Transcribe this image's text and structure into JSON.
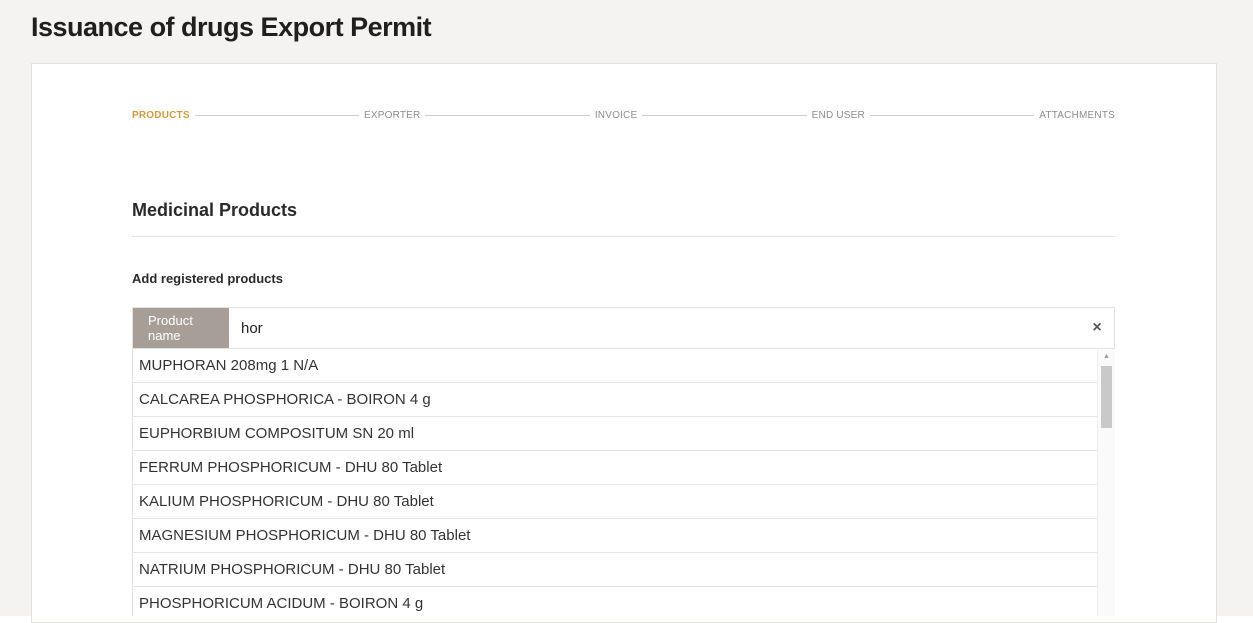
{
  "page": {
    "title": "Issuance of drugs Export Permit"
  },
  "stepper": {
    "steps": [
      "PRODUCTS",
      "EXPORTER",
      "INVOICE",
      "END USER",
      "ATTACHMENTS"
    ],
    "active_step": "PRODUCTS"
  },
  "section": {
    "title": "Medicinal Products",
    "subtitle": "Add registered products"
  },
  "search": {
    "label": "Product name",
    "value": "hor",
    "clear_symbol": "×"
  },
  "dropdown": {
    "items": [
      "MUPHORAN 208mg 1 N/A",
      "CALCAREA PHOSPHORICA - BOIRON 4 g",
      "EUPHORBIUM COMPOSITUM SN 20 ml",
      "FERRUM PHOSPHORICUM - DHU 80 Tablet",
      "KALIUM PHOSPHORICUM - DHU 80 Tablet",
      "MAGNESIUM PHOSPHORICUM - DHU 80 Tablet",
      "NATRIUM PHOSPHORICUM - DHU 80 Tablet",
      "PHOSPHORICUM ACIDUM - BOIRON 4 g"
    ],
    "scroll_up_symbol": "▲"
  },
  "colors": {
    "accent": "#d39a3a",
    "label_bg": "#a79f97",
    "page_bg": "#f4f3f1"
  }
}
